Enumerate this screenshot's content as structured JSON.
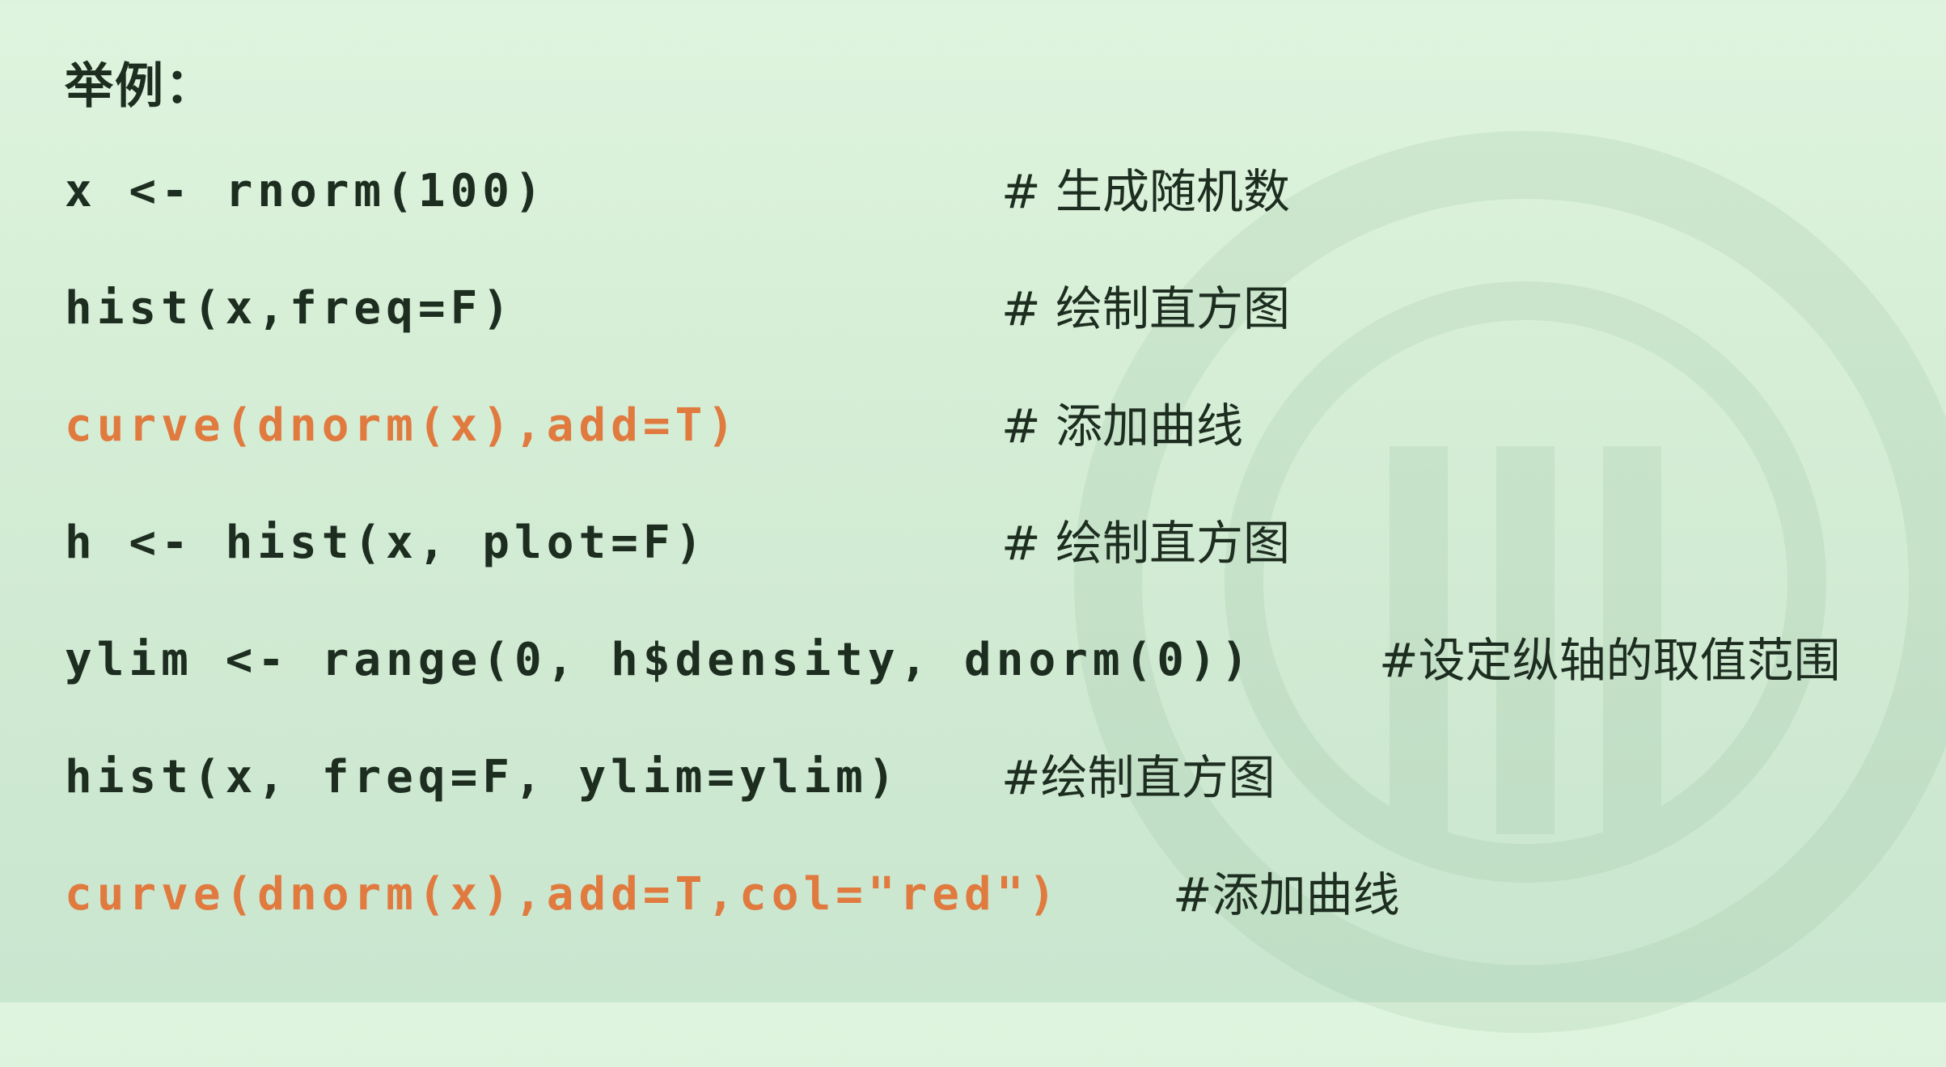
{
  "heading": "举例：",
  "lines": [
    {
      "code": "x <- rnorm(100)",
      "comment": "#  生成随机数",
      "highlight": false
    },
    {
      "code": "hist(x,freq=F)",
      "comment": "#  绘制直方图",
      "highlight": false
    },
    {
      "code": "curve(dnorm(x),add=T)",
      "comment": "#  添加曲线",
      "highlight": true
    },
    {
      "code": "h <- hist(x, plot=F)",
      "comment": "#  绘制直方图",
      "highlight": false
    },
    {
      "code": "ylim <- range(0, h$density, dnorm(0))",
      "comment": "#设定纵轴的取值范围",
      "highlight": false
    },
    {
      "code": "hist(x, freq=F, ylim=ylim)",
      "comment": "#绘制直方图",
      "highlight": false
    },
    {
      "code": "curve(dnorm(x),add=T,col=\"red\")",
      "comment": "#添加曲线",
      "highlight": true
    }
  ],
  "colors": {
    "text": "#1d2d20",
    "highlight": "#e07a3f",
    "background": "#d6eed6"
  }
}
